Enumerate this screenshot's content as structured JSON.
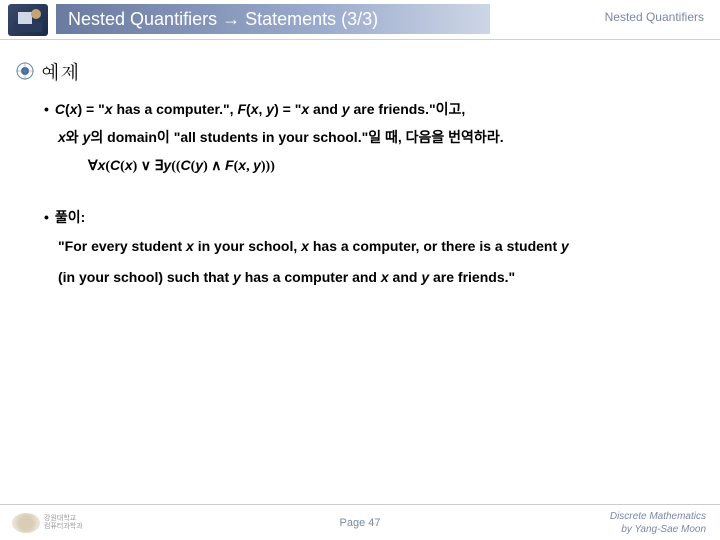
{
  "header": {
    "title": "Nested Quantifiers → Statements (3/3)",
    "right": "Nested Quantifiers"
  },
  "example": {
    "marker_label": "예제",
    "bullet1_a": "C",
    "bullet1_b": "(",
    "bullet1_c": "x",
    "bullet1_d": ") = \"",
    "bullet1_e": "x",
    "bullet1_f": " has a computer.\", ",
    "bullet1_g": "F",
    "bullet1_h": "(",
    "bullet1_i": "x",
    "bullet1_j": ", ",
    "bullet1_k": "y",
    "bullet1_l": ") = \"",
    "bullet1_m": "x",
    "bullet1_n": " and ",
    "bullet1_o": "y",
    "bullet1_p": " are friends.\"이고,",
    "bullet1_line2_a": "x",
    "bullet1_line2_b": "와 ",
    "bullet1_line2_c": "y",
    "bullet1_line2_d": "의 domain이 \"all students in your school.\"일 때, 다음을 번역하라.",
    "formula": "∀x(C(x) ∨ ∃y((C(y) ∧ F(x, y)))",
    "bullet2_label": "풀이:",
    "solution_a": "\"For every student ",
    "solution_b": "x",
    "solution_c": " in your school, ",
    "solution_d": "x",
    "solution_e": " has a computer, or there is a student ",
    "solution_f": "y",
    "solution_g": "(in your school) such that ",
    "solution_h": "y",
    "solution_i": " has a computer and ",
    "solution_j": "x",
    "solution_k": " and ",
    "solution_l": "y",
    "solution_m": " are friends.\""
  },
  "footer": {
    "page": "Page 47",
    "right1": "Discrete Mathematics",
    "right2": "by Yang-Sae Moon"
  }
}
